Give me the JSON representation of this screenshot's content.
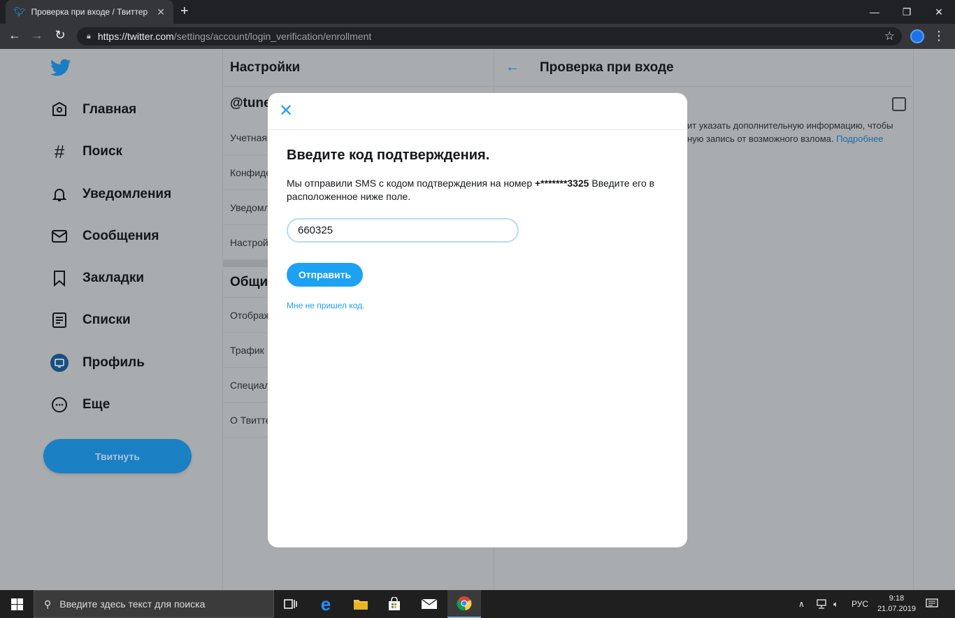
{
  "browser": {
    "tab_title": "Проверка при входе / Твиттер",
    "url_host": "https://twitter.com",
    "url_path": "/settings/account/login_verification/enrollment"
  },
  "sidebar": {
    "items": [
      {
        "label": "Главная",
        "icon": "home-icon"
      },
      {
        "label": "Поиск",
        "icon": "hashtag-icon"
      },
      {
        "label": "Уведомления",
        "icon": "bell-icon"
      },
      {
        "label": "Сообщения",
        "icon": "envelope-icon"
      },
      {
        "label": "Закладки",
        "icon": "bookmark-icon"
      },
      {
        "label": "Списки",
        "icon": "list-icon"
      },
      {
        "label": "Профиль",
        "icon": "avatar-icon"
      },
      {
        "label": "Еще",
        "icon": "more-icon"
      }
    ],
    "tweet_button": "Твитнуть"
  },
  "settings": {
    "header": "Настройки",
    "handle": "@tune",
    "rows": [
      "Учетная",
      "Конфиде",
      "Уведомл",
      "Настрой"
    ],
    "section": "Общи",
    "rows2": [
      "Отображ",
      "Трафик",
      "Специал",
      "О Твитте"
    ]
  },
  "detail": {
    "title": "Проверка при входе",
    "text": "ит указать дополнительную информацию, чтобы ную запись от возможного взлома.",
    "more_link": "Подробнее"
  },
  "modal": {
    "title": "Введите код подтверждения.",
    "desc_prefix": "Мы отправили SMS с кодом подтверждения на номер",
    "phone": "+*******3325",
    "desc_suffix": "Введите его в расположенное ниже поле.",
    "code_value": "660325",
    "send_button": "Отправить",
    "no_code_link": "Мне не пришел код."
  },
  "taskbar": {
    "search_placeholder": "Введите здесь текст для поиска",
    "lang": "РУС",
    "time": "9:18",
    "date": "21.07.2019"
  }
}
